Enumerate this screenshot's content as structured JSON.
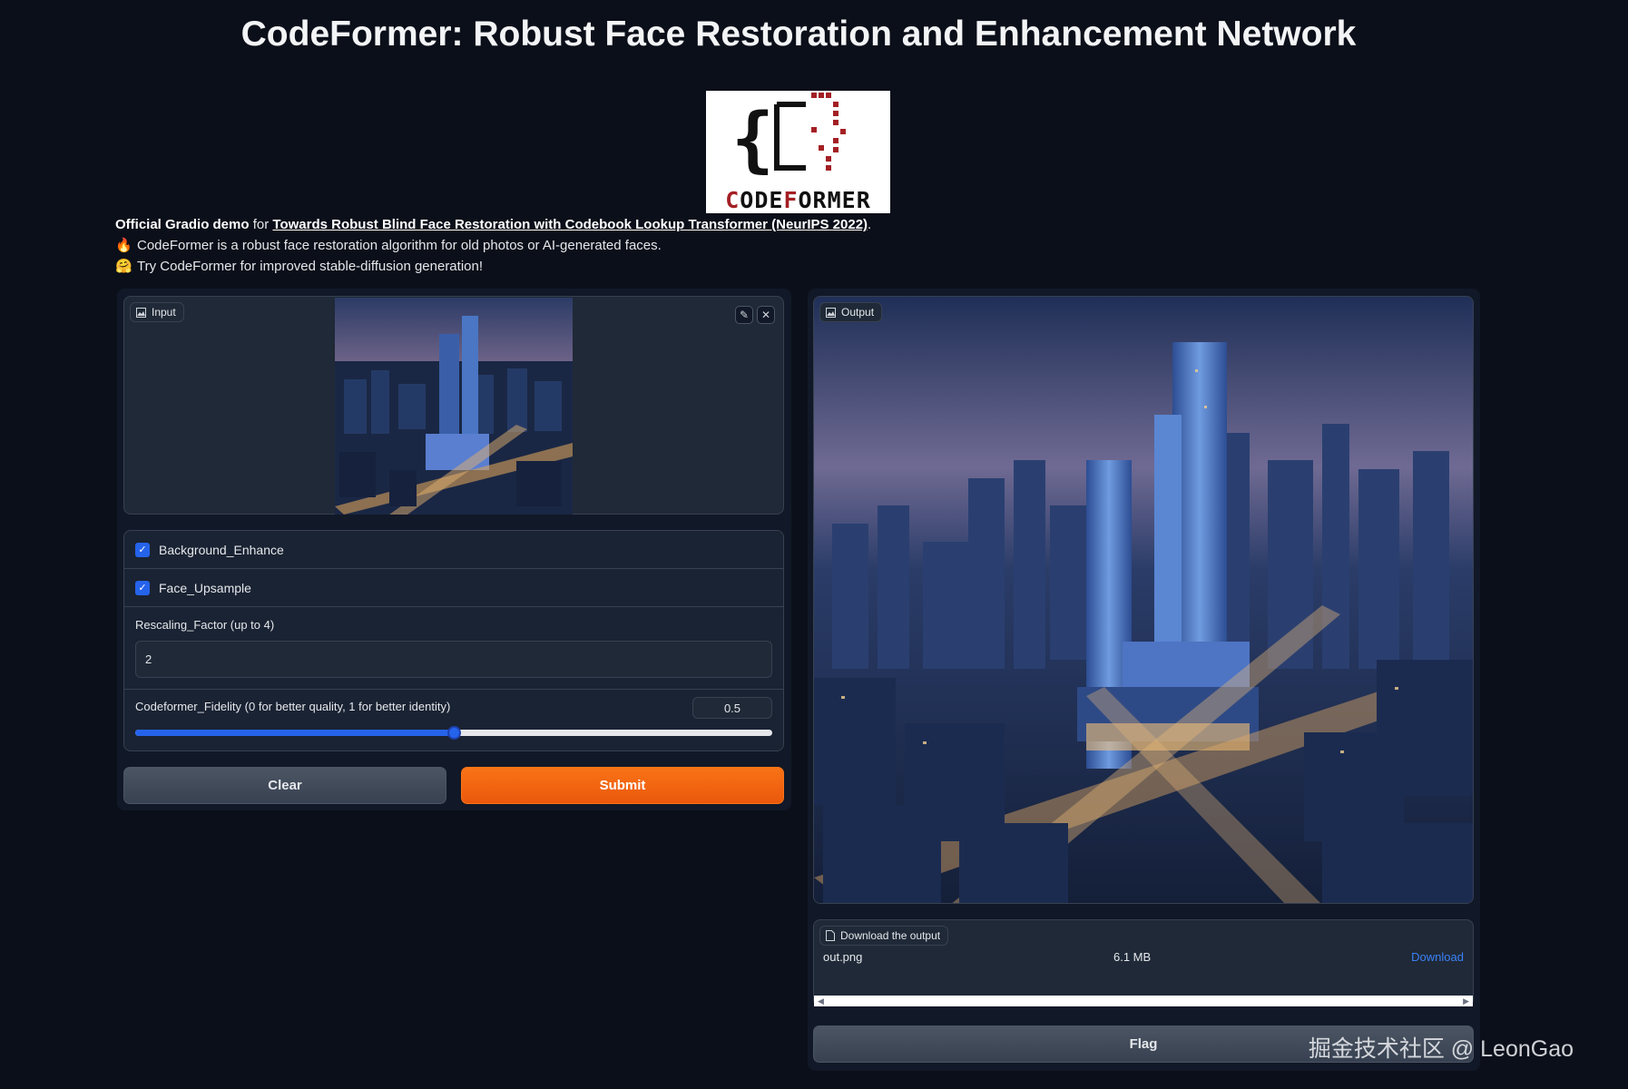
{
  "title": "CodeFormer: Robust Face Restoration and Enhancement Network",
  "logo": {
    "text_part1": "C",
    "text_part2": "ODE",
    "text_part3": "F",
    "text_part4": "ORMER"
  },
  "description": {
    "line1_strong": "Official Gradio demo",
    "line1_for": "for",
    "line1_link": "Towards Robust Blind Face Restoration with Codebook Lookup Transformer (NeurIPS 2022)",
    "line1_end": ".",
    "line2_emoji": "🔥",
    "line2_text": "CodeFormer is a robust face restoration algorithm for old photos or AI-generated faces.",
    "line3_emoji": "🤗",
    "line3_text": "Try CodeFormer for improved stable-diffusion generation!"
  },
  "input_panel": {
    "label": "Input",
    "edit_icon": "pencil-icon",
    "clear_icon": "close-icon"
  },
  "options": {
    "background_enhance": {
      "label": "Background_Enhance",
      "checked": true
    },
    "face_upsample": {
      "label": "Face_Upsample",
      "checked": true
    },
    "rescaling": {
      "label": "Rescaling_Factor (up to 4)",
      "value": "2"
    },
    "fidelity": {
      "label": "Codeformer_Fidelity (0 for better quality, 1 for better identity)",
      "value": "0.5",
      "fraction": 0.5
    }
  },
  "buttons": {
    "clear": "Clear",
    "submit": "Submit",
    "flag": "Flag"
  },
  "output_panel": {
    "label": "Output"
  },
  "download": {
    "label": "Download the output",
    "filename": "out.png",
    "size": "6.1 MB",
    "link": "Download"
  },
  "watermark": "掘金技术社区 @ LeonGao",
  "colors": {
    "background": "#0b0f19",
    "panel": "#1f2937",
    "accent_blue": "#2563eb",
    "accent_orange": "#f97316",
    "link_blue": "#3b82f6"
  }
}
